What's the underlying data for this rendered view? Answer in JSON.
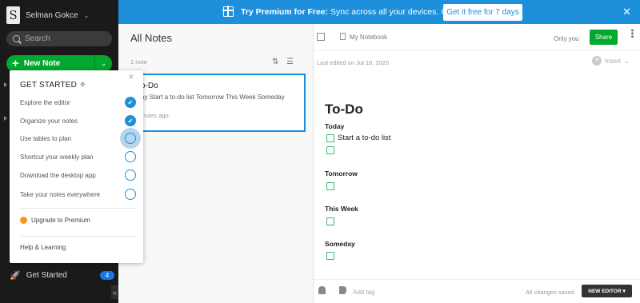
{
  "sidebar": {
    "account_initial": "S",
    "account_name": "Selman Gokce",
    "search_placeholder": "Search",
    "new_note_label": "New Note",
    "get_started_label": "Get Started",
    "get_started_badge": "4"
  },
  "banner": {
    "title": "Try Premium for Free:",
    "text": "Sync across all your devices. Cancel anytime.",
    "cta": "Get it free for 7 days",
    "close": "✕"
  },
  "note_list": {
    "title": "All Notes",
    "count": "1 note",
    "card": {
      "title": "o-Do",
      "snippet": "ay Start a to-do list Tomorrow This Week Someday",
      "time": "inutes ago"
    }
  },
  "popup": {
    "heading": "GET STARTED",
    "tasks": [
      {
        "label": "Explore the editor",
        "done": true
      },
      {
        "label": "Organize your notes",
        "done": true
      },
      {
        "label": "Use tables to plan",
        "done": false
      },
      {
        "label": "Shortcut your weekly plan",
        "done": false
      },
      {
        "label": "Download the desktop app",
        "done": false
      },
      {
        "label": "Take your notes everywhere",
        "done": false
      }
    ],
    "upgrade_label": "Upgrade to Premium",
    "help_label": "Help & Learning"
  },
  "editor": {
    "notebook": "My Notebook",
    "sharing": "Only you",
    "share_label": "Share",
    "last_edited": "Last edited on Jul 18, 2020",
    "insert_label": "Insert",
    "doc_title": "To-Do",
    "sections": [
      {
        "heading": "Today",
        "item": "Start a to-do list"
      },
      {
        "heading": "Tomorrow",
        "item": ""
      },
      {
        "heading": "This Week",
        "item": ""
      },
      {
        "heading": "Someday",
        "item": ""
      }
    ],
    "add_tag": "Add tag",
    "saved_status": "All changes saved",
    "new_editor_label": "NEW EDITOR"
  },
  "colors": {
    "accent_green": "#00a82d",
    "banner_blue": "#1d8fdb",
    "sidebar_bg": "#1a1a1a"
  }
}
